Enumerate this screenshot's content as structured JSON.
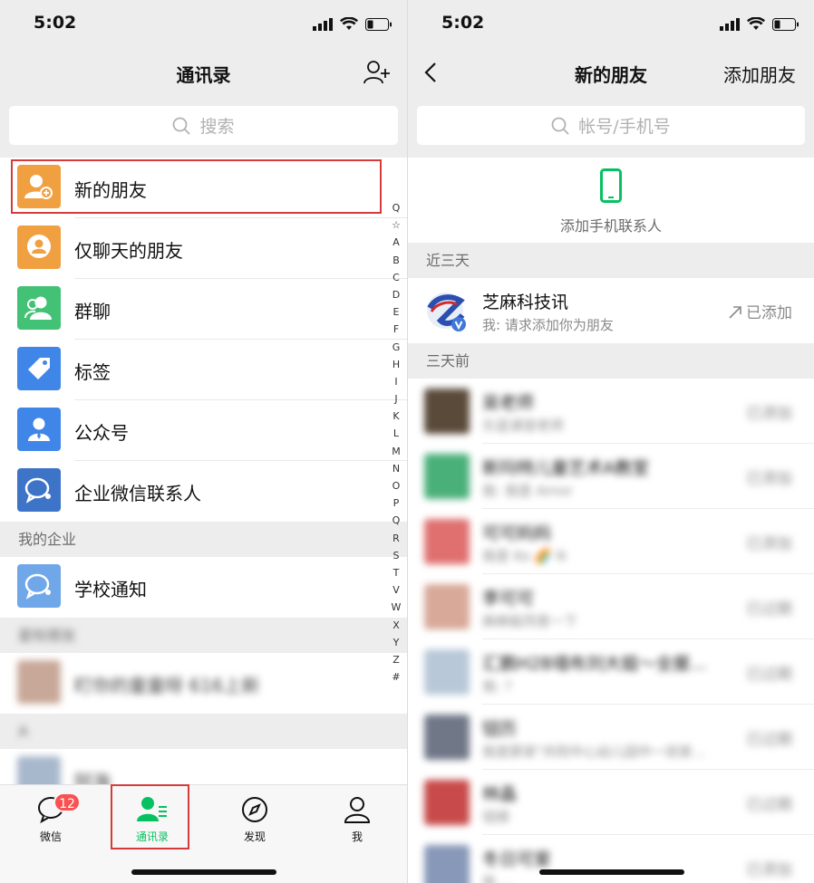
{
  "left": {
    "status": {
      "time": "5:02"
    },
    "title": "通讯录",
    "search_placeholder": "搜索",
    "top_items": [
      {
        "label": "新的朋友",
        "color": "#f0a040"
      },
      {
        "label": "仅聊天的朋友",
        "color": "#f0a040"
      },
      {
        "label": "群聊",
        "color": "#43c174"
      },
      {
        "label": "标签",
        "color": "#3f86e8"
      },
      {
        "label": "公众号",
        "color": "#3f86e8"
      },
      {
        "label": "企业微信联系人",
        "color": "#3d74c8"
      }
    ],
    "section_enterprise": "我的企业",
    "enterprise_items": [
      {
        "label": "学校通知"
      }
    ],
    "section_starred": "星标朋友",
    "starred_items": [
      {
        "label": "盯你的童童呀 616上新"
      }
    ],
    "section_a": "A",
    "a_items": [
      {
        "label": "阿海"
      }
    ],
    "index": [
      "Q",
      "☆",
      "A",
      "B",
      "C",
      "D",
      "E",
      "F",
      "G",
      "H",
      "I",
      "J",
      "K",
      "L",
      "M",
      "N",
      "O",
      "P",
      "Q",
      "R",
      "S",
      "T",
      "V",
      "W",
      "X",
      "Y",
      "Z",
      "#"
    ],
    "tabs": [
      {
        "label": "微信",
        "badge": "12"
      },
      {
        "label": "通讯录"
      },
      {
        "label": "发现"
      },
      {
        "label": "我"
      }
    ]
  },
  "right": {
    "status": {
      "time": "5:02"
    },
    "title": "新的朋友",
    "add_friend": "添加朋友",
    "search_placeholder": "帐号/手机号",
    "add_phone_contacts": "添加手机联系人",
    "section_recent": "近三天",
    "recent": [
      {
        "name": "芝麻科技讯",
        "message": "我: 请求添加你为朋友",
        "status": "已添加"
      }
    ],
    "section_older": "三天前",
    "older": [
      {
        "name": "吴老师",
        "message": "乐蓝课堂老师",
        "status": "已添加"
      },
      {
        "name": "新玛特儿童艺术A教室",
        "message": "我: 我是 Amor",
        "status": "已添加"
      },
      {
        "name": "可可妈妈",
        "message": "我是 Ko 🌈 N",
        "status": "已添加"
      },
      {
        "name": "李可可",
        "message": "麻麻能同意一下",
        "status": "已过期"
      },
      {
        "name": "汇鹏H2B墙布刘大姐～全屋...",
        "message": "我: ?",
        "status": "已过期"
      },
      {
        "name": "钮历",
        "message": "我是那家\"共阳中心幼儿园中一班家...",
        "status": "已过期"
      },
      {
        "name": "林晶",
        "message": "钮顺",
        "status": "已过期"
      },
      {
        "name": "冬日可爱",
        "message": "我 ... ",
        "status": "已添加"
      }
    ]
  }
}
